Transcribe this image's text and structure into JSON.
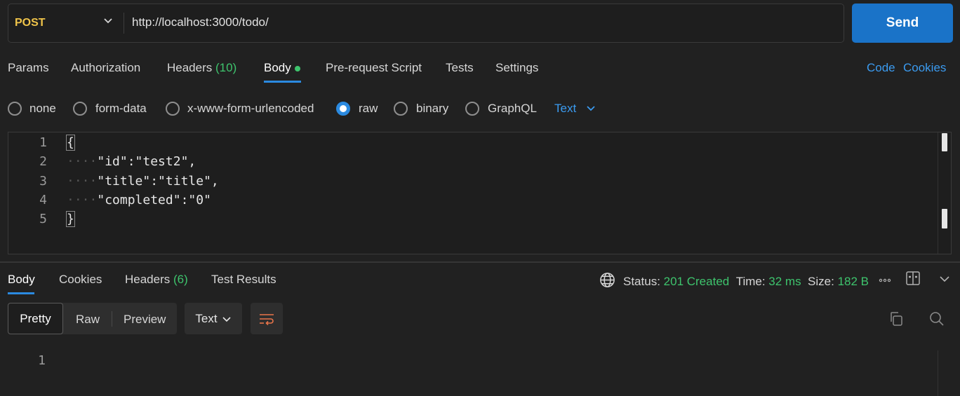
{
  "request": {
    "method": "POST",
    "url": "http://localhost:3000/todo/",
    "send_label": "Send"
  },
  "request_tabs": [
    {
      "label": "Params"
    },
    {
      "label": "Authorization"
    },
    {
      "label": "Headers",
      "count": "(10)"
    },
    {
      "label": "Body",
      "active": true
    },
    {
      "label": "Pre-request Script"
    },
    {
      "label": "Tests"
    },
    {
      "label": "Settings"
    }
  ],
  "links": {
    "code": "Code",
    "cookies": "Cookies"
  },
  "body_types": {
    "none": "none",
    "form_data": "form-data",
    "urlencoded": "x-www-form-urlencoded",
    "raw": "raw",
    "binary": "binary",
    "graphql": "GraphQL",
    "selected": "raw",
    "format": "Text"
  },
  "editor": {
    "line_numbers": [
      "1",
      "2",
      "3",
      "4",
      "5"
    ],
    "lines": [
      "{",
      "\"id\":\"test2\",",
      "\"title\":\"title\",",
      "\"completed\":\"0\"",
      "}"
    ],
    "indent": "····"
  },
  "response_tabs": [
    {
      "label": "Body",
      "active": true
    },
    {
      "label": "Cookies"
    },
    {
      "label": "Headers",
      "count": "(6)"
    },
    {
      "label": "Test Results"
    }
  ],
  "status": {
    "status_label": "Status:",
    "status_value": "201 Created",
    "time_label": "Time:",
    "time_value": "32 ms",
    "size_label": "Size:",
    "size_value": "182 B"
  },
  "response_toolbar": {
    "pretty": "Pretty",
    "raw": "Raw",
    "preview": "Preview",
    "format": "Text"
  },
  "response_body": {
    "line_numbers": [
      "1"
    ]
  },
  "colors": {
    "accent": "#2b8ae0",
    "send_button": "#1a73c8",
    "method": "#f0c44a",
    "success": "#3ec46d"
  }
}
